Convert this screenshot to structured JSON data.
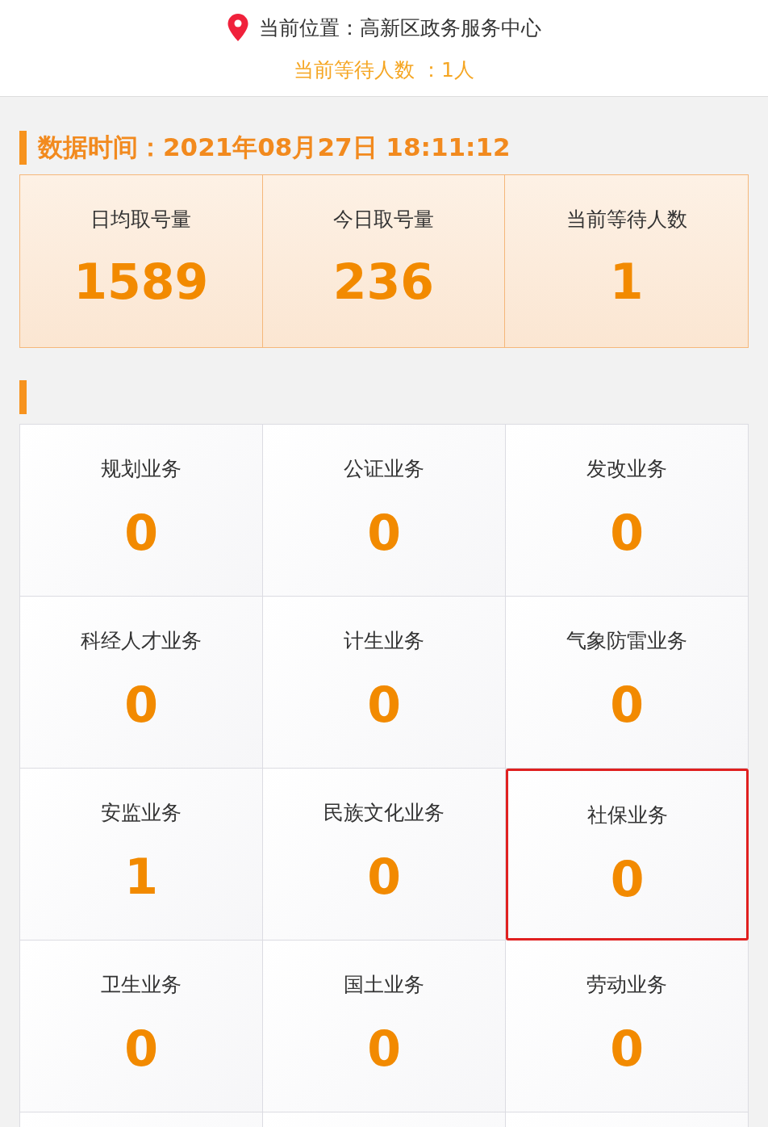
{
  "header": {
    "location_label": "当前位置：高新区政务服务中心",
    "waiting": "当前等待人数 ：1人"
  },
  "data_time": "数据时间：2021年08月27日 18:11:12",
  "stats": [
    {
      "label": "日均取号量",
      "value": "1589"
    },
    {
      "label": "今日取号量",
      "value": "236"
    },
    {
      "label": "当前等待人数",
      "value": "1"
    }
  ],
  "services": [
    {
      "label": "规划业务",
      "value": "0",
      "highlighted": false
    },
    {
      "label": "公证业务",
      "value": "0",
      "highlighted": false
    },
    {
      "label": "发改业务",
      "value": "0",
      "highlighted": false
    },
    {
      "label": "科经人才业务",
      "value": "0",
      "highlighted": false
    },
    {
      "label": "计生业务",
      "value": "0",
      "highlighted": false
    },
    {
      "label": "气象防雷业务",
      "value": "0",
      "highlighted": false
    },
    {
      "label": "安监业务",
      "value": "1",
      "highlighted": false
    },
    {
      "label": "民族文化业务",
      "value": "0",
      "highlighted": false
    },
    {
      "label": "社保业务",
      "value": "0",
      "highlighted": true
    },
    {
      "label": "卫生业务",
      "value": "0",
      "highlighted": false
    },
    {
      "label": "国土业务",
      "value": "0",
      "highlighted": false
    },
    {
      "label": "劳动业务",
      "value": "0",
      "highlighted": false
    }
  ]
}
